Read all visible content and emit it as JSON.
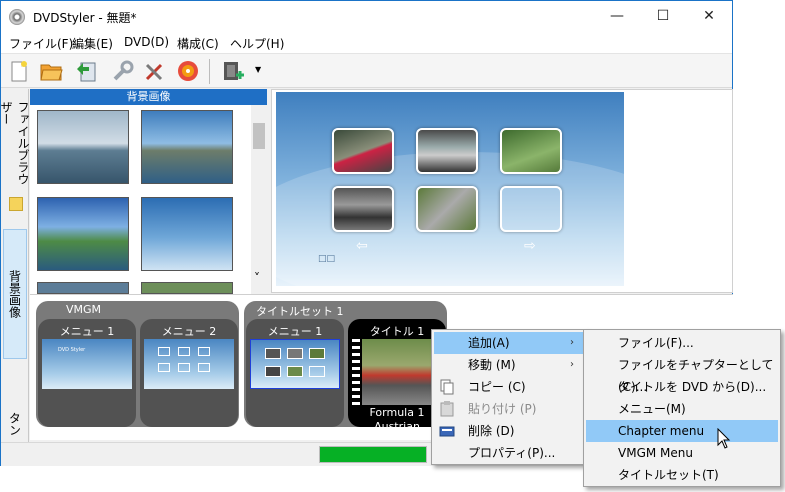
{
  "window": {
    "title": "DVDStyler - 無題*",
    "minimize": "—",
    "maximize": "☐",
    "close": "✕"
  },
  "menubar": [
    "ファイル(F)",
    "編集(E)",
    "DVD(D)",
    "構成(C)",
    "ヘルプ(H)"
  ],
  "toolbar": {
    "icons": [
      "new-icon",
      "open-icon",
      "save-icon",
      "wrench-icon",
      "settings-icon",
      "burn-icon",
      "add-video-icon",
      "dropdown-arrow-icon"
    ],
    "dropdown_glyph": "▼"
  },
  "vtabs": {
    "file_browser": "ファイルブラウザー",
    "backgrounds": "背景画像",
    "buttons": "タン"
  },
  "bg_panel": {
    "header": "背景画像",
    "scroll_down": "˅"
  },
  "preview": {
    "arrow_left": "⇦",
    "arrow_right": "⇨",
    "small_buttons": "□□"
  },
  "timeline": {
    "vmgm_label": "VMGM",
    "vmgm_menus": [
      "メニュー 1",
      "メニュー 2"
    ],
    "titleset_label": "タイトルセット 1",
    "titleset_menu": "メニュー 1",
    "title_card": "タイトル 1",
    "title_caption_line1": "Formula 1",
    "title_caption_line2": "Austrian",
    "mini_text": "DVD Styler"
  },
  "status": {
    "progress_percent": 100
  },
  "context_menu": {
    "items": [
      {
        "label": "追加(A)",
        "submenu": true,
        "highlighted": true
      },
      {
        "label": "移動 (M)",
        "submenu": true
      },
      {
        "label": "コピー (C)",
        "icon": "copy-icon"
      },
      {
        "label": "貼り付け (P)",
        "icon": "paste-icon",
        "disabled": true
      },
      {
        "label": "削除 (D)",
        "icon": "delete-icon"
      },
      {
        "label": "プロパティ(P)..."
      }
    ],
    "submenu_glyph": "›"
  },
  "submenu": {
    "items": [
      {
        "label": "ファイル(F)..."
      },
      {
        "label": "ファイルをチャプターとして(C)..."
      },
      {
        "label": "タイトルを DVD から(D)..."
      },
      {
        "label": "メニュー(M)"
      },
      {
        "label": "Chapter menu",
        "highlighted": true
      },
      {
        "label": "VMGM Menu"
      },
      {
        "label": "タイトルセット(T)"
      }
    ]
  },
  "colors": {
    "accent": "#1f6fc5",
    "highlight": "#91c9f7",
    "progress": "#06b025"
  }
}
